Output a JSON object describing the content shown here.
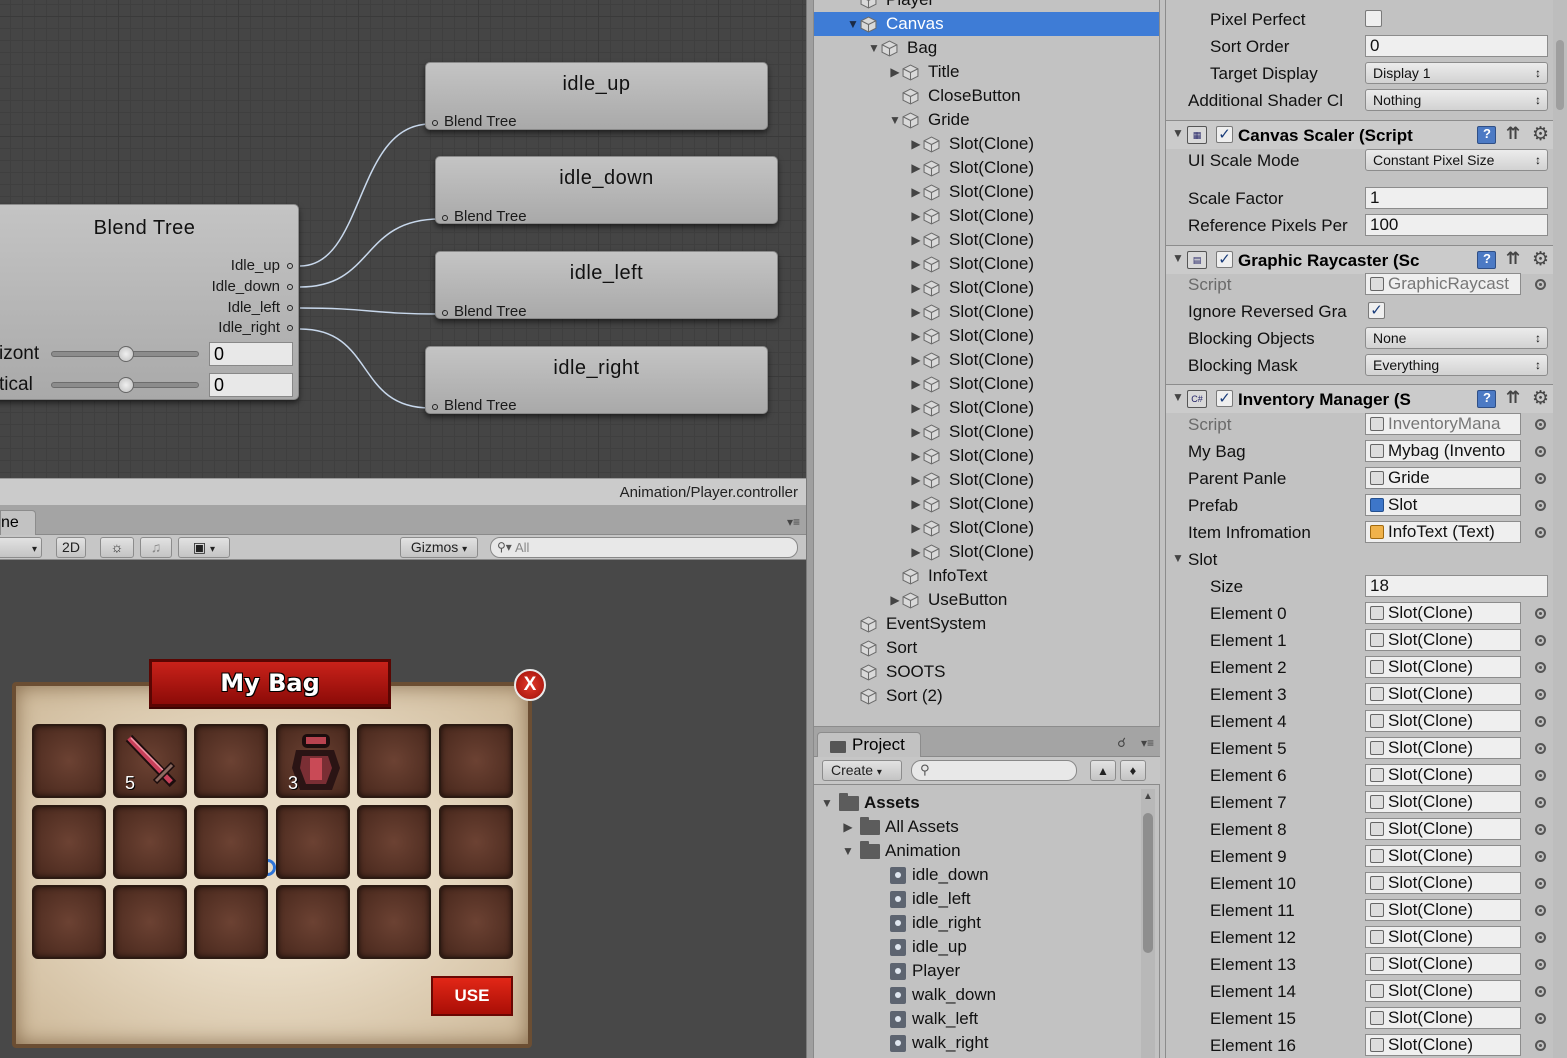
{
  "animator": {
    "states": [
      {
        "name": "idle_up",
        "sub": "Blend Tree"
      },
      {
        "name": "idle_down",
        "sub": "Blend Tree"
      },
      {
        "name": "idle_left",
        "sub": "Blend Tree"
      },
      {
        "name": "idle_right",
        "sub": "Blend Tree"
      }
    ],
    "blend_tree": {
      "title": "Blend Tree",
      "outputs": [
        "Idle_up",
        "Idle_down",
        "Idle_left",
        "Idle_right"
      ],
      "params": [
        {
          "label": "izont",
          "value": "0",
          "level": 0.5
        },
        {
          "label": "tical",
          "value": "0",
          "level": 0.5
        }
      ]
    },
    "path": "Animation/Player.controller"
  },
  "scene": {
    "tab_label": "ne",
    "toolbar": {
      "mode_2d": "2D",
      "gizmos": "Gizmos",
      "search_placeholder": "All"
    },
    "bag": {
      "title": "My Bag",
      "close_label": "X",
      "use_label": "USE",
      "slots": [
        {
          "count": ""
        },
        {
          "count": "5"
        },
        {
          "count": ""
        },
        {
          "count": "3"
        },
        {
          "count": ""
        },
        {
          "count": ""
        },
        {
          "count": ""
        },
        {
          "count": ""
        },
        {
          "count": ""
        },
        {
          "count": ""
        },
        {
          "count": ""
        },
        {
          "count": ""
        },
        {
          "count": ""
        },
        {
          "count": ""
        },
        {
          "count": ""
        },
        {
          "count": ""
        },
        {
          "count": ""
        },
        {
          "count": ""
        }
      ]
    }
  },
  "hierarchy": {
    "items": [
      {
        "label": "Player",
        "depth": 0,
        "arrow": "",
        "selected": false
      },
      {
        "label": "Canvas",
        "depth": 0,
        "arrow": "open",
        "selected": true
      },
      {
        "label": "Bag",
        "depth": 1,
        "arrow": "open",
        "selected": false
      },
      {
        "label": "Title",
        "depth": 2,
        "arrow": "closed",
        "selected": false
      },
      {
        "label": "CloseButton",
        "depth": 2,
        "arrow": "",
        "selected": false
      },
      {
        "label": "Gride",
        "depth": 2,
        "arrow": "open",
        "selected": false
      },
      {
        "label": "Slot(Clone)",
        "depth": 3,
        "arrow": "closed",
        "selected": false
      },
      {
        "label": "Slot(Clone)",
        "depth": 3,
        "arrow": "closed",
        "selected": false
      },
      {
        "label": "Slot(Clone)",
        "depth": 3,
        "arrow": "closed",
        "selected": false
      },
      {
        "label": "Slot(Clone)",
        "depth": 3,
        "arrow": "closed",
        "selected": false
      },
      {
        "label": "Slot(Clone)",
        "depth": 3,
        "arrow": "closed",
        "selected": false
      },
      {
        "label": "Slot(Clone)",
        "depth": 3,
        "arrow": "closed",
        "selected": false
      },
      {
        "label": "Slot(Clone)",
        "depth": 3,
        "arrow": "closed",
        "selected": false
      },
      {
        "label": "Slot(Clone)",
        "depth": 3,
        "arrow": "closed",
        "selected": false
      },
      {
        "label": "Slot(Clone)",
        "depth": 3,
        "arrow": "closed",
        "selected": false
      },
      {
        "label": "Slot(Clone)",
        "depth": 3,
        "arrow": "closed",
        "selected": false
      },
      {
        "label": "Slot(Clone)",
        "depth": 3,
        "arrow": "closed",
        "selected": false
      },
      {
        "label": "Slot(Clone)",
        "depth": 3,
        "arrow": "closed",
        "selected": false
      },
      {
        "label": "Slot(Clone)",
        "depth": 3,
        "arrow": "closed",
        "selected": false
      },
      {
        "label": "Slot(Clone)",
        "depth": 3,
        "arrow": "closed",
        "selected": false
      },
      {
        "label": "Slot(Clone)",
        "depth": 3,
        "arrow": "closed",
        "selected": false
      },
      {
        "label": "Slot(Clone)",
        "depth": 3,
        "arrow": "closed",
        "selected": false
      },
      {
        "label": "Slot(Clone)",
        "depth": 3,
        "arrow": "closed",
        "selected": false
      },
      {
        "label": "Slot(Clone)",
        "depth": 3,
        "arrow": "closed",
        "selected": false
      },
      {
        "label": "InfoText",
        "depth": 2,
        "arrow": "",
        "selected": false
      },
      {
        "label": "UseButton",
        "depth": 2,
        "arrow": "closed",
        "selected": false
      },
      {
        "label": "EventSystem",
        "depth": 0,
        "arrow": "",
        "selected": false
      },
      {
        "label": "Sort",
        "depth": 0,
        "arrow": "",
        "selected": false
      },
      {
        "label": "SOOTS",
        "depth": 0,
        "arrow": "",
        "selected": false
      },
      {
        "label": "Sort (2)",
        "depth": 0,
        "arrow": "",
        "selected": false
      }
    ]
  },
  "project": {
    "tab_label": "Project",
    "create_label": "Create",
    "items": [
      {
        "label": "Assets",
        "depth": 0,
        "arrow": "open",
        "icon": "folder",
        "bold": true
      },
      {
        "label": "All Assets",
        "depth": 1,
        "arrow": "closed",
        "icon": "folder",
        "bold": false
      },
      {
        "label": "Animation",
        "depth": 1,
        "arrow": "open",
        "icon": "folder",
        "bold": false
      },
      {
        "label": "idle_down",
        "depth": 2,
        "arrow": "",
        "icon": "anim",
        "bold": false
      },
      {
        "label": "idle_left",
        "depth": 2,
        "arrow": "",
        "icon": "anim",
        "bold": false
      },
      {
        "label": "idle_right",
        "depth": 2,
        "arrow": "",
        "icon": "anim",
        "bold": false
      },
      {
        "label": "idle_up",
        "depth": 2,
        "arrow": "",
        "icon": "anim",
        "bold": false
      },
      {
        "label": "Player",
        "depth": 2,
        "arrow": "",
        "icon": "controller",
        "bold": false
      },
      {
        "label": "walk_down",
        "depth": 2,
        "arrow": "",
        "icon": "anim",
        "bold": false
      },
      {
        "label": "walk_left",
        "depth": 2,
        "arrow": "",
        "icon": "anim",
        "bold": false
      },
      {
        "label": "walk_right",
        "depth": 2,
        "arrow": "",
        "icon": "anim",
        "bold": false
      }
    ]
  },
  "inspector": {
    "canvas": {
      "pixel_perfect_label": "Pixel Perfect",
      "sort_order_label": "Sort Order",
      "sort_order": "0",
      "target_display_label": "Target Display",
      "target_display": "Display 1",
      "shader_label": "Additional Shader Cl",
      "shader": "Nothing"
    },
    "canvas_scaler": {
      "title": "Canvas Scaler (Script",
      "ui_scale_mode_label": "UI Scale Mode",
      "ui_scale_mode": "Constant Pixel Size",
      "scale_factor_label": "Scale Factor",
      "scale_factor": "1",
      "ref_pixels_label": "Reference Pixels Per",
      "ref_pixels": "100"
    },
    "graphic_raycaster": {
      "title": "Graphic Raycaster (Sc",
      "script_label": "Script",
      "script": "GraphicRaycast",
      "ignore_label": "Ignore Reversed Gra",
      "blocking_objects_label": "Blocking Objects",
      "blocking_objects": "None",
      "blocking_mask_label": "Blocking Mask",
      "blocking_mask": "Everything"
    },
    "inventory_manager": {
      "title": "Inventory Manager (S",
      "script_label": "Script",
      "script": "InventoryMana",
      "my_bag_label": "My Bag",
      "my_bag": "Mybag (Invento",
      "parent_label": "Parent Panle",
      "parent": "Gride",
      "prefab_label": "Prefab",
      "prefab": "Slot",
      "info_label": "Item Infromation",
      "info": "InfoText (Text)",
      "slot_label": "Slot",
      "size_label": "Size",
      "size": "18",
      "elements": [
        {
          "label": "Element 0",
          "value": "Slot(Clone)"
        },
        {
          "label": "Element 1",
          "value": "Slot(Clone)"
        },
        {
          "label": "Element 2",
          "value": "Slot(Clone)"
        },
        {
          "label": "Element 3",
          "value": "Slot(Clone)"
        },
        {
          "label": "Element 4",
          "value": "Slot(Clone)"
        },
        {
          "label": "Element 5",
          "value": "Slot(Clone)"
        },
        {
          "label": "Element 6",
          "value": "Slot(Clone)"
        },
        {
          "label": "Element 7",
          "value": "Slot(Clone)"
        },
        {
          "label": "Element 8",
          "value": "Slot(Clone)"
        },
        {
          "label": "Element 9",
          "value": "Slot(Clone)"
        },
        {
          "label": "Element 10",
          "value": "Slot(Clone)"
        },
        {
          "label": "Element 11",
          "value": "Slot(Clone)"
        },
        {
          "label": "Element 12",
          "value": "Slot(Clone)"
        },
        {
          "label": "Element 13",
          "value": "Slot(Clone)"
        },
        {
          "label": "Element 14",
          "value": "Slot(Clone)"
        },
        {
          "label": "Element 15",
          "value": "Slot(Clone)"
        },
        {
          "label": "Element 16",
          "value": "Slot(Clone)"
        }
      ]
    }
  }
}
